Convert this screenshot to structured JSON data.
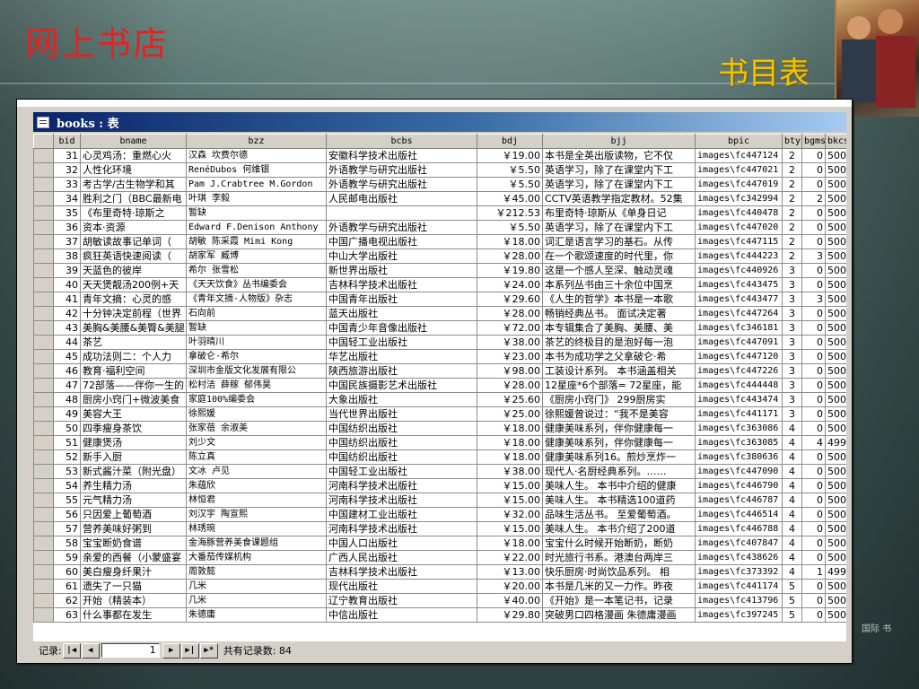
{
  "slide": {
    "site_title": "网上书店",
    "subtitle": "书目表",
    "corner_text": "国际 书"
  },
  "window": {
    "title": "books : 表",
    "columns": [
      "bid",
      "bname",
      "bzz",
      "bcbs",
      "bdj",
      "bjj",
      "bpic",
      "bty",
      "bgms",
      "bkcs"
    ],
    "rows": [
      [
        "31",
        "心灵鸡汤：重燃心火",
        "汉森 坎费尔德",
        "安徽科学技术出版社",
        "￥19.00",
        "本书是全英出版读物，它不仅",
        "images\\fc447124",
        "2",
        "0",
        "500"
      ],
      [
        "32",
        "人性化环境",
        "RenéDubos 何维银",
        "外语教学与研究出版社",
        "￥5.50",
        "英语学习，除了在课堂内下工",
        "images\\fc447021",
        "2",
        "0",
        "500"
      ],
      [
        "33",
        "考古学/古生物学和其",
        "Pam J.Crabtree M.Gordon",
        "外语教学与研究出版社",
        "￥5.50",
        "英语学习，除了在课堂内下工",
        "images\\fc447019",
        "2",
        "0",
        "500"
      ],
      [
        "34",
        "胜利之门（BBC最新电",
        "叶琪 李毅",
        "人民邮电出版社",
        "￥45.00",
        "CCTV英语教学指定教材。52集",
        "images\\fc342994",
        "2",
        "2",
        "500"
      ],
      [
        "35",
        "《布里奇特·琼斯之",
        "暂缺",
        "",
        "￥212.53",
        "布里奇特·琼斯从《单身日记",
        "images\\fc440478",
        "2",
        "0",
        "500"
      ],
      [
        "36",
        "资本·资源",
        "Edward F.Denison Anthony",
        "外语教学与研究出版社",
        "￥5.50",
        "英语学习，除了在课堂内下工",
        "images\\fc447020",
        "2",
        "0",
        "500"
      ],
      [
        "37",
        "胡敏读故事记单词（",
        "胡敏 陈采霞 Mimi Kong",
        "中国广播电视出版社",
        "￥18.00",
        "词汇是语言学习的基石。从传",
        "images\\fc447115",
        "2",
        "0",
        "500"
      ],
      [
        "38",
        "疯狂英语快速阅读（",
        "胡家军 臧博",
        "中山大学出版社",
        "￥28.00",
        "在一个歌颂速度的时代里，你",
        "images\\fc444223",
        "2",
        "3",
        "500"
      ],
      [
        "39",
        "天蓝色的彼岸",
        "希尔 张雪松",
        "新世界出版社",
        "￥19.80",
        "这是一个感人至深、触动灵魂",
        "images\\fc440926",
        "3",
        "0",
        "500"
      ],
      [
        "40",
        "天天煲靓汤200例+天",
        "《天天饮食》丛书编委会",
        "吉林科学技术出版社",
        "￥24.00",
        "本系列丛书由三十余位中国烹",
        "images\\fc443475",
        "3",
        "0",
        "500"
      ],
      [
        "41",
        "青年文摘：心灵的感",
        "《青年文摘·人物版》杂志",
        "中国青年出版社",
        "￥29.60",
        "《人生的哲学》本书是一本歌",
        "images\\fc443477",
        "3",
        "3",
        "500"
      ],
      [
        "42",
        "十分钟决定前程（世界",
        "石向前",
        "蓝天出版社",
        "￥28.00",
        "畅销经典丛书。 面试决定著",
        "images\\fc447264",
        "3",
        "0",
        "500"
      ],
      [
        "43",
        "美胸&美腰&美臀&美腿",
        "暂缺",
        "中国青少年音像出版社",
        "￥72.00",
        "本专辑集合了美胸、美腰、美",
        "images\\fc346181",
        "3",
        "0",
        "500"
      ],
      [
        "44",
        "茶艺",
        "叶羽晴川",
        "中国轻工业出版社",
        "￥38.00",
        "茶艺的终极目的是泡好每一泡",
        "images\\fc447091",
        "3",
        "0",
        "500"
      ],
      [
        "45",
        "成功法则二：个人力",
        "拿破仑·希尔",
        "华艺出版社",
        "￥23.00",
        "本书为成功学之父拿破仑·希",
        "images\\fc447120",
        "3",
        "0",
        "500"
      ],
      [
        "46",
        "教育·福利空间",
        "深圳市金版文化发展有限公",
        "陕西旅游出版社",
        "￥98.00",
        "工装设计系列。 本书涵盖相关",
        "images\\fc447226",
        "3",
        "0",
        "500"
      ],
      [
        "47",
        "72部落——伴你一生的",
        "松村洁 薛稼 郁伟昊",
        "中国民族摄影艺术出版社",
        "￥28.00",
        "12星座*6个部落= 72星座，能",
        "images\\fc444448",
        "3",
        "0",
        "500"
      ],
      [
        "48",
        "厨房小窍门+微波美食",
        "家庭100%编委会",
        "大象出版社",
        "￥25.60",
        "《厨房小窍门》 299厨房实",
        "images\\fc443474",
        "3",
        "0",
        "500"
      ],
      [
        "49",
        "美容大王",
        "徐熙媛",
        "当代世界出版社",
        "￥25.00",
        "徐熙媛曾说过：“我不是美容",
        "images\\fc441171",
        "3",
        "0",
        "500"
      ],
      [
        "50",
        "四季瘦身茶饮",
        "张家蓓 余淑美",
        "中国纺织出版社",
        "￥18.00",
        "健康美味系列，伴你健康每一",
        "images\\fc363086",
        "4",
        "0",
        "500"
      ],
      [
        "51",
        "健康煲汤",
        "刘少文",
        "中国纺织出版社",
        "￥18.00",
        "健康美味系列，伴你健康每一",
        "images\\fc363085",
        "4",
        "4",
        "499"
      ],
      [
        "52",
        "新手入厨",
        "陈立真",
        "中国纺织出版社",
        "￥18.00",
        "健康美味系列16。煎炒烹炸一",
        "images\\fc380636",
        "4",
        "0",
        "500"
      ],
      [
        "53",
        "新式酱汁菜（附光盘）",
        "文冰 卢见",
        "中国轻工业出版社",
        "￥38.00",
        "现代人·名厨经典系列。……",
        "images\\fc447090",
        "4",
        "0",
        "500"
      ],
      [
        "54",
        "养生精力汤",
        "朱蕴欣",
        "河南科学技术出版社",
        "￥15.00",
        "美味人生。 本书中介绍的健康",
        "images\\fc446790",
        "4",
        "0",
        "500"
      ],
      [
        "55",
        "元气精力汤",
        "林恒君",
        "河南科学技术出版社",
        "￥15.00",
        "美味人生。 本书精选100道药",
        "images\\fc446787",
        "4",
        "0",
        "500"
      ],
      [
        "56",
        "只因爱上葡萄酒",
        "刘汉宇 陶宣熙",
        "中国建材工业出版社",
        "￥32.00",
        "品味生活丛书。 至爱葡萄酒。",
        "images\\fc446514",
        "4",
        "0",
        "500"
      ],
      [
        "57",
        "营养美味好粥到",
        "林琇琬",
        "河南科学技术出版社",
        "￥15.00",
        "美味人生。 本书介绍了200道",
        "images\\fc446788",
        "4",
        "0",
        "500"
      ],
      [
        "58",
        "宝宝断奶食谱",
        "金海豚营养美食课题组",
        "中国人口出版社",
        "￥18.00",
        "宝宝什么时候开始断奶，断奶",
        "images\\fc407847",
        "4",
        "0",
        "500"
      ],
      [
        "59",
        "亲爱的西餐（小蒙盛宴",
        "大番茄传媒机构",
        "广西人民出版社",
        "￥22.00",
        "时光旅行书系。港澳台两岸三",
        "images\\fc438626",
        "4",
        "0",
        "500"
      ],
      [
        "60",
        "美白瘦身纤果汁",
        "周敦懿",
        "吉林科学技术出版社",
        "￥13.00",
        "快乐厨房·时尚饮品系列。 相",
        "images\\fc373392",
        "4",
        "1",
        "499"
      ],
      [
        "61",
        "遗失了一只猫",
        "几米",
        "现代出版社",
        "￥20.00",
        "本书是几米的又一力作。昨夜",
        "images\\fc441174",
        "5",
        "0",
        "500"
      ],
      [
        "62",
        "开始（精装本）",
        "几米",
        "辽宁教育出版社",
        "￥40.00",
        "《开始》是一本笔记书，记录",
        "images\\fc413796",
        "5",
        "0",
        "500"
      ],
      [
        "63",
        "什么事都在发生",
        "朱德庸",
        "中信出版社",
        "￥29.80",
        "突破男口四格漫画 朱德庸漫画",
        "images\\fc397245",
        "5",
        "0",
        "500"
      ]
    ],
    "status": {
      "record_label": "记录:",
      "current_record": "1",
      "total_label": "共有记录数: 84",
      "nav_first": "|◀",
      "nav_prev": "◀",
      "nav_next": "▶",
      "nav_last": "▶|",
      "nav_new": "▶*"
    }
  }
}
